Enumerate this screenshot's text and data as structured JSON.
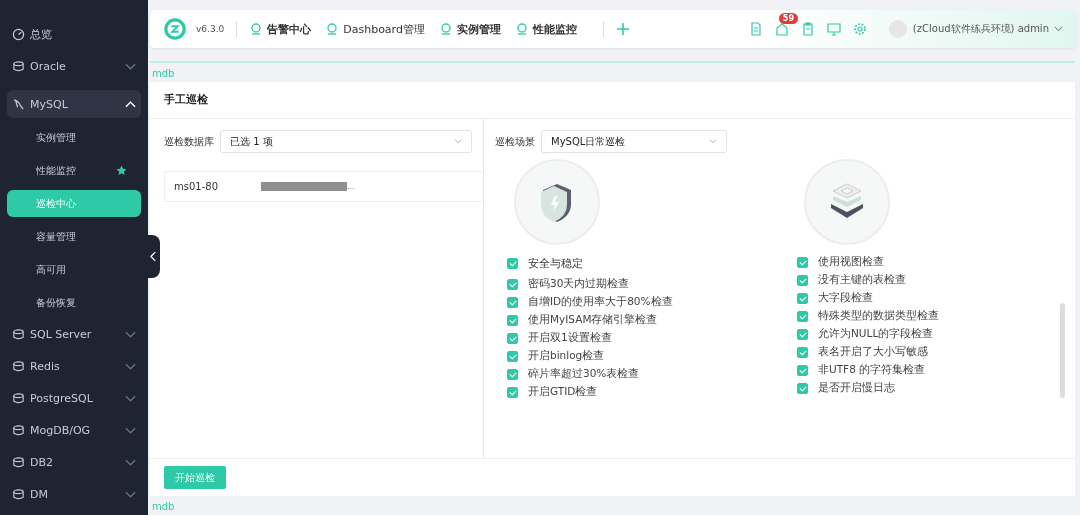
{
  "sidebar": {
    "items": [
      {
        "label": "总览",
        "kind": "plain"
      },
      {
        "label": "Oracle",
        "kind": "group",
        "expanded": false
      },
      {
        "label": "MySQL",
        "kind": "group",
        "expanded": true,
        "children": [
          {
            "label": "实例管理",
            "selected": false,
            "favorite": false
          },
          {
            "label": "性能监控",
            "selected": false,
            "favorite": true
          },
          {
            "label": "巡检中心",
            "selected": true,
            "favorite": false
          },
          {
            "label": "容量管理",
            "selected": false,
            "favorite": false
          },
          {
            "label": "高可用",
            "selected": false,
            "favorite": false
          },
          {
            "label": "备份恢复",
            "selected": false,
            "favorite": false
          }
        ]
      },
      {
        "label": "SQL Server",
        "kind": "group",
        "expanded": false
      },
      {
        "label": "Redis",
        "kind": "group",
        "expanded": false
      },
      {
        "label": "PostgreSQL",
        "kind": "group",
        "expanded": false
      },
      {
        "label": "MogDB/OG",
        "kind": "group",
        "expanded": false
      },
      {
        "label": "DB2",
        "kind": "group",
        "expanded": false
      },
      {
        "label": "DM",
        "kind": "group",
        "expanded": false
      }
    ]
  },
  "topbar": {
    "version": "v6.3.0",
    "tabs": [
      {
        "label": "告警中心",
        "selected": true
      },
      {
        "label": "Dashboard管理",
        "selected": false
      },
      {
        "label": "实例管理",
        "selected": true
      },
      {
        "label": "性能监控",
        "selected": true
      }
    ],
    "badge": "59",
    "user": "(zCloud软件练兵环境) admin"
  },
  "breadcrumb_top": "mdb",
  "card": {
    "title": "手工巡检",
    "db_label": "巡检数据库",
    "db_value": "已选 1 项",
    "instances": [
      {
        "name": "ms01-80",
        "address_suffix": "..."
      }
    ],
    "scene_label": "巡检场景",
    "scene_value": "MySQL日常巡检",
    "groups": [
      {
        "title": "安全与稳定",
        "checked": true,
        "items": [
          {
            "label": "密码30天内过期检查",
            "checked": true
          },
          {
            "label": "自增ID的使用率大于80%检查",
            "checked": true
          },
          {
            "label": "使用MyISAM存储引擎检查",
            "checked": true
          },
          {
            "label": "开启双1设置检查",
            "checked": true
          },
          {
            "label": "开启binlog检查",
            "checked": true
          },
          {
            "label": "碎片率超过30%表检查",
            "checked": true
          },
          {
            "label": "开启GTID检查",
            "checked": true
          }
        ]
      },
      {
        "items": [
          {
            "label": "使用视图检查",
            "checked": true
          },
          {
            "label": "没有主键的表检查",
            "checked": true
          },
          {
            "label": "大字段检查",
            "checked": true
          },
          {
            "label": "特殊类型的数据类型检查",
            "checked": true
          },
          {
            "label": "允许为NULL的字段检查",
            "checked": true
          },
          {
            "label": "表名开启了大小写敏感",
            "checked": true
          },
          {
            "label": "非UTF8 的字符集检查",
            "checked": true
          },
          {
            "label": "是否开启慢日志",
            "checked": true
          }
        ]
      }
    ],
    "button": "开始巡检"
  },
  "breadcrumb_bottom": "mdb"
}
